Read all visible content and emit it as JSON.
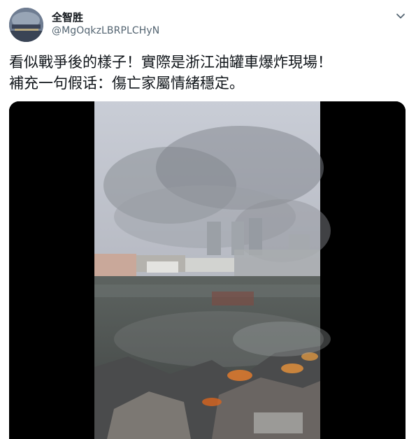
{
  "tweet": {
    "author_name": "全智胜",
    "author_handle": "@MgOqkzLBRPLCHyN",
    "text_lines": [
      "看似戰爭後的樣子！實際是浙江油罐車爆炸現場！",
      "補充一句假话：傷亡家屬情緒穩定。"
    ]
  },
  "icons": {
    "avatar": "profile-photo",
    "menu": "chevron-down-icon"
  },
  "colors": {
    "text_primary": "#0f1419",
    "text_secondary": "#536471",
    "media_background": "#000000"
  }
}
